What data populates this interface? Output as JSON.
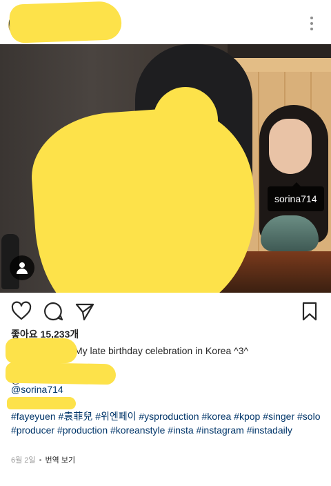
{
  "header": {
    "more_icon": "more-vertical-icon"
  },
  "photo": {
    "tag_label": "sorina714",
    "people_icon": "person-icon"
  },
  "actions": {
    "like_icon": "heart-icon",
    "comment_icon": "comment-icon",
    "share_icon": "send-icon",
    "save_icon": "bookmark-icon"
  },
  "post": {
    "likes": "좋아요 15,233개",
    "caption_text": "My late birthday celebration in Korea ^3^",
    "stub_text": "@...",
    "mention": "@sorina714",
    "hashtags": [
      "#fayeyuen",
      "#袁菲兒",
      "#위엔페이",
      "#ysproduction",
      "#korea",
      "#kpop",
      "#singer",
      "#solo",
      "#producer",
      "#production",
      "#koreanstyle",
      "#insta",
      "#instagram",
      "#instadaily"
    ],
    "date": "6월 2일",
    "separator": "•",
    "translate": "번역 보기"
  },
  "colors": {
    "link": "#003569",
    "redaction": "#fde24a",
    "meta": "#999999"
  }
}
